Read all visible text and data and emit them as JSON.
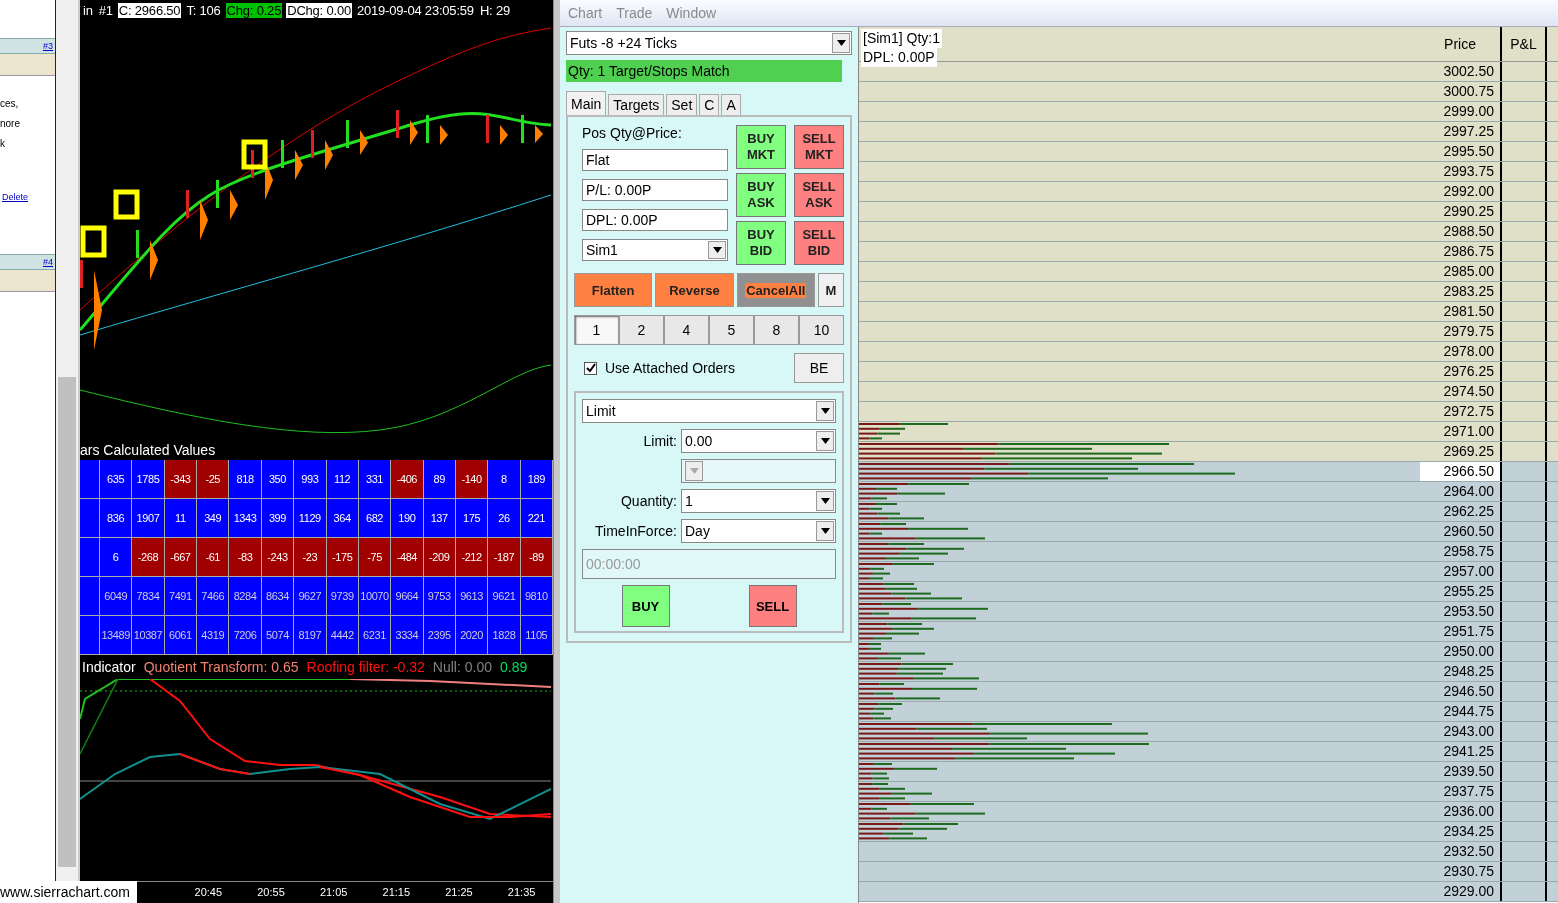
{
  "sidebar": {
    "items": [
      {
        "kind": "header",
        "text": "#3"
      },
      {
        "kind": "text",
        "text": "ces,"
      },
      {
        "kind": "text",
        "text": "nore"
      },
      {
        "kind": "text",
        "text": "k"
      },
      {
        "kind": "link",
        "text": "Delete"
      },
      {
        "kind": "header",
        "text": "#4"
      }
    ]
  },
  "chart": {
    "header": [
      {
        "text": "in"
      },
      {
        "text": "#1"
      },
      {
        "text": "C: 2966.50",
        "color": "#ffffff"
      },
      {
        "text": "T: 106"
      },
      {
        "text": "Chg: 0.25",
        "color": "#00c000"
      },
      {
        "text": "DChg: 0.00",
        "color": "#ffffff"
      },
      {
        "text": "2019-09-04 23:05:59"
      },
      {
        "text": "H: 29"
      }
    ],
    "table_title": "ars Calculated Values",
    "table_rows": [
      [
        {
          "color": "#0000ff"
        },
        {
          "v": "635",
          "color": "#0000ff"
        },
        {
          "v": "1785",
          "color": "#0000ff"
        },
        {
          "v": "-343",
          "color": "#a00000"
        },
        {
          "v": "-25",
          "color": "#a00000"
        },
        {
          "v": "818",
          "color": "#0000ff"
        },
        {
          "v": "350",
          "color": "#0000ff"
        },
        {
          "v": "993",
          "color": "#0000ff"
        },
        {
          "v": "112",
          "color": "#0000ff"
        },
        {
          "v": "331",
          "color": "#0000ff"
        },
        {
          "v": "-406",
          "color": "#a00000"
        },
        {
          "v": "89",
          "color": "#0000ff"
        },
        {
          "v": "-140",
          "color": "#a00000"
        },
        {
          "v": "8",
          "color": "#0000ff"
        },
        {
          "v": "189",
          "color": "#0000ff"
        }
      ],
      [
        {
          "color": "#0000ff"
        },
        {
          "v": "836",
          "color": "#0000ff"
        },
        {
          "v": "1907",
          "color": "#0000ff"
        },
        {
          "v": "11",
          "color": "#0000ff"
        },
        {
          "v": "349",
          "color": "#0000ff"
        },
        {
          "v": "1343",
          "color": "#0000ff"
        },
        {
          "v": "399",
          "color": "#0000ff"
        },
        {
          "v": "1129",
          "color": "#0000ff"
        },
        {
          "v": "364",
          "color": "#0000ff"
        },
        {
          "v": "682",
          "color": "#0000ff"
        },
        {
          "v": "190",
          "color": "#0000ff"
        },
        {
          "v": "137",
          "color": "#0000ff"
        },
        {
          "v": "175",
          "color": "#0000ff"
        },
        {
          "v": "26",
          "color": "#0000ff"
        },
        {
          "v": "221",
          "color": "#0000ff"
        }
      ],
      [
        {
          "color": "#0000ff"
        },
        {
          "v": "6",
          "color": "#0000ff"
        },
        {
          "v": "-268",
          "color": "#a00000"
        },
        {
          "v": "-667",
          "color": "#a00000"
        },
        {
          "v": "-61",
          "color": "#a00000"
        },
        {
          "v": "-83",
          "color": "#a00000"
        },
        {
          "v": "-243",
          "color": "#a00000"
        },
        {
          "v": "-23",
          "color": "#a00000"
        },
        {
          "v": "-175",
          "color": "#a00000"
        },
        {
          "v": "-75",
          "color": "#a00000"
        },
        {
          "v": "-484",
          "color": "#a00000"
        },
        {
          "v": "-209",
          "color": "#a00000"
        },
        {
          "v": "-212",
          "color": "#a00000"
        },
        {
          "v": "-187",
          "color": "#a00000"
        },
        {
          "v": "-89",
          "color": "#a00000"
        }
      ],
      [
        {
          "color": "#0000ff"
        },
        {
          "v": "6049",
          "color": "#0000ff"
        },
        {
          "v": "7834",
          "color": "#0000ff"
        },
        {
          "v": "7491",
          "color": "#0000ff"
        },
        {
          "v": "7466",
          "color": "#0000ff"
        },
        {
          "v": "8284",
          "color": "#0000ff"
        },
        {
          "v": "8634",
          "color": "#0000ff"
        },
        {
          "v": "9627",
          "color": "#0000ff"
        },
        {
          "v": "9739",
          "color": "#0000ff"
        },
        {
          "v": "10070",
          "color": "#0000ff"
        },
        {
          "v": "9664",
          "color": "#0000ff"
        },
        {
          "v": "9753",
          "color": "#0000ff"
        },
        {
          "v": "9613",
          "color": "#0000ff"
        },
        {
          "v": "9621",
          "color": "#0000ff"
        },
        {
          "v": "9810",
          "color": "#0000ff"
        }
      ],
      [
        {
          "color": "#0000ff"
        },
        {
          "v": "13489",
          "color": "#0000ff"
        },
        {
          "v": "10387",
          "color": "#0000ff"
        },
        {
          "v": "6061",
          "color": "#0000ff"
        },
        {
          "v": "4319",
          "color": "#0000ff"
        },
        {
          "v": "7206",
          "color": "#0000ff"
        },
        {
          "v": "5074",
          "color": "#0000ff"
        },
        {
          "v": "8197",
          "color": "#0000ff"
        },
        {
          "v": "4442",
          "color": "#0000ff"
        },
        {
          "v": "6231",
          "color": "#0000ff"
        },
        {
          "v": "3334",
          "color": "#0000ff"
        },
        {
          "v": "2395",
          "color": "#0000ff"
        },
        {
          "v": "2020",
          "color": "#0000ff"
        },
        {
          "v": "1828",
          "color": "#0000ff"
        },
        {
          "v": "1105",
          "color": "#0000ff"
        }
      ]
    ],
    "indicator_header": [
      {
        "text": "Indicator",
        "color": "#ffffff"
      },
      {
        "text": "Quotient Transform: 0.65",
        "color": "#f08070"
      },
      {
        "text": "Roofing filter: -0.32",
        "color": "#ff1010"
      },
      {
        "text": "Null: 0.00",
        "color": "#808080"
      },
      {
        "text": "0.89",
        "color": "#00e060"
      }
    ],
    "time_axis": [
      "20:45",
      "20:55",
      "21:05",
      "21:15",
      "21:25",
      "21:35"
    ],
    "footer_link": "www.sierrachart.com"
  },
  "menu": [
    {
      "label": "Chart",
      "disabled": true
    },
    {
      "label": "Trade",
      "disabled": true
    },
    {
      "label": "Window",
      "disabled": true
    }
  ],
  "trade": {
    "strategy": "Futs -8 +24 Ticks",
    "status": "Qty: 1 Target/Stops Match",
    "tabs": [
      {
        "label": "Main",
        "selected": true
      },
      {
        "label": "Targets",
        "selected": false
      },
      {
        "label": "Set",
        "selected": false
      },
      {
        "label": "C",
        "selected": false
      },
      {
        "label": "A",
        "selected": false
      }
    ],
    "position_label": "Pos Qty@Price:",
    "position_fields": [
      "Flat",
      "P/L: 0.00P",
      "DPL: 0.00P"
    ],
    "account": "Sim1",
    "order_buttons": [
      {
        "label": "BUY MKT",
        "kind": "buy"
      },
      {
        "label": "SELL MKT",
        "kind": "sell"
      },
      {
        "label": "BUY ASK",
        "kind": "buy"
      },
      {
        "label": "SELL ASK",
        "kind": "sell"
      },
      {
        "label": "BUY BID",
        "kind": "buy"
      },
      {
        "label": "SELL BID",
        "kind": "sell"
      }
    ],
    "action_buttons": [
      {
        "label": "Flatten",
        "kind": "orange"
      },
      {
        "label": "Reverse",
        "kind": "orange"
      },
      {
        "label": "CancelAll",
        "kind": "cancel"
      },
      {
        "label": "M",
        "kind": "plain"
      }
    ],
    "quantities": [
      {
        "label": "1",
        "selected": true
      },
      {
        "label": "2",
        "selected": false
      },
      {
        "label": "4",
        "selected": false
      },
      {
        "label": "5",
        "selected": false
      },
      {
        "label": "8",
        "selected": false
      },
      {
        "label": "10",
        "selected": false
      }
    ],
    "attached_orders": {
      "label": "Use Attached Orders",
      "checked": true
    },
    "be_button": "BE",
    "order_type": "Limit",
    "order_fields": [
      {
        "label": "Limit:",
        "value": "0.00",
        "disabled": false
      },
      {
        "disabled": true
      },
      {
        "label": "Quantity:",
        "value": "1",
        "disabled": false
      },
      {
        "label": "TimeInForce:",
        "value": "Day",
        "disabled": false
      }
    ],
    "time": "00:00:00",
    "submit_buttons": [
      {
        "label": "BUY",
        "kind": "buy"
      },
      {
        "label": "SELL",
        "kind": "sell"
      }
    ]
  },
  "ladder": {
    "account": "[Sim1]  Qty:1",
    "dpl": "DPL: 0.00P",
    "columns": [
      "Price",
      "P&L"
    ],
    "rows": [
      {
        "price": "3002.50",
        "ask": true,
        "current": false
      },
      {
        "price": "3000.75",
        "ask": true,
        "current": false
      },
      {
        "price": "2999.00",
        "ask": true,
        "current": false
      },
      {
        "price": "2997.25",
        "ask": true,
        "current": false
      },
      {
        "price": "2995.50",
        "ask": true,
        "current": false
      },
      {
        "price": "2993.75",
        "ask": true,
        "current": false
      },
      {
        "price": "2992.00",
        "ask": true,
        "current": false
      },
      {
        "price": "2990.25",
        "ask": true,
        "current": false
      },
      {
        "price": "2988.50",
        "ask": true,
        "current": false
      },
      {
        "price": "2986.75",
        "ask": true,
        "current": false
      },
      {
        "price": "2985.00",
        "ask": true,
        "current": false
      },
      {
        "price": "2983.25",
        "ask": true,
        "current": false
      },
      {
        "price": "2981.50",
        "ask": true,
        "current": false
      },
      {
        "price": "2979.75",
        "ask": true,
        "current": false
      },
      {
        "price": "2978.00",
        "ask": true,
        "current": false
      },
      {
        "price": "2976.25",
        "ask": true,
        "current": false
      },
      {
        "price": "2974.50",
        "ask": true,
        "current": false
      },
      {
        "price": "2972.75",
        "ask": true,
        "current": false
      },
      {
        "price": "2971.00",
        "ask": true,
        "current": false
      },
      {
        "price": "2969.25",
        "ask": true,
        "current": false
      },
      {
        "price": "2966.50",
        "ask": false,
        "current": true
      },
      {
        "price": "2964.00",
        "ask": false,
        "current": false
      },
      {
        "price": "2962.25",
        "ask": false,
        "current": false
      },
      {
        "price": "2960.50",
        "ask": false,
        "current": false
      },
      {
        "price": "2958.75",
        "ask": false,
        "current": false
      },
      {
        "price": "2957.00",
        "ask": false,
        "current": false
      },
      {
        "price": "2955.25",
        "ask": false,
        "current": false
      },
      {
        "price": "2953.50",
        "ask": false,
        "current": false
      },
      {
        "price": "2951.75",
        "ask": false,
        "current": false
      },
      {
        "price": "2950.00",
        "ask": false,
        "current": false
      },
      {
        "price": "2948.25",
        "ask": false,
        "current": false
      },
      {
        "price": "2946.50",
        "ask": false,
        "current": false
      },
      {
        "price": "2944.75",
        "ask": false,
        "current": false
      },
      {
        "price": "2943.00",
        "ask": false,
        "current": false
      },
      {
        "price": "2941.25",
        "ask": false,
        "current": false
      },
      {
        "price": "2939.50",
        "ask": false,
        "current": false
      },
      {
        "price": "2937.75",
        "ask": false,
        "current": false
      },
      {
        "price": "2936.00",
        "ask": false,
        "current": false
      },
      {
        "price": "2934.25",
        "ask": false,
        "current": false
      },
      {
        "price": "2932.50",
        "ask": false,
        "current": false
      },
      {
        "price": "2930.75",
        "ask": false,
        "current": false
      },
      {
        "price": "2929.00",
        "ask": false,
        "current": false
      }
    ]
  }
}
